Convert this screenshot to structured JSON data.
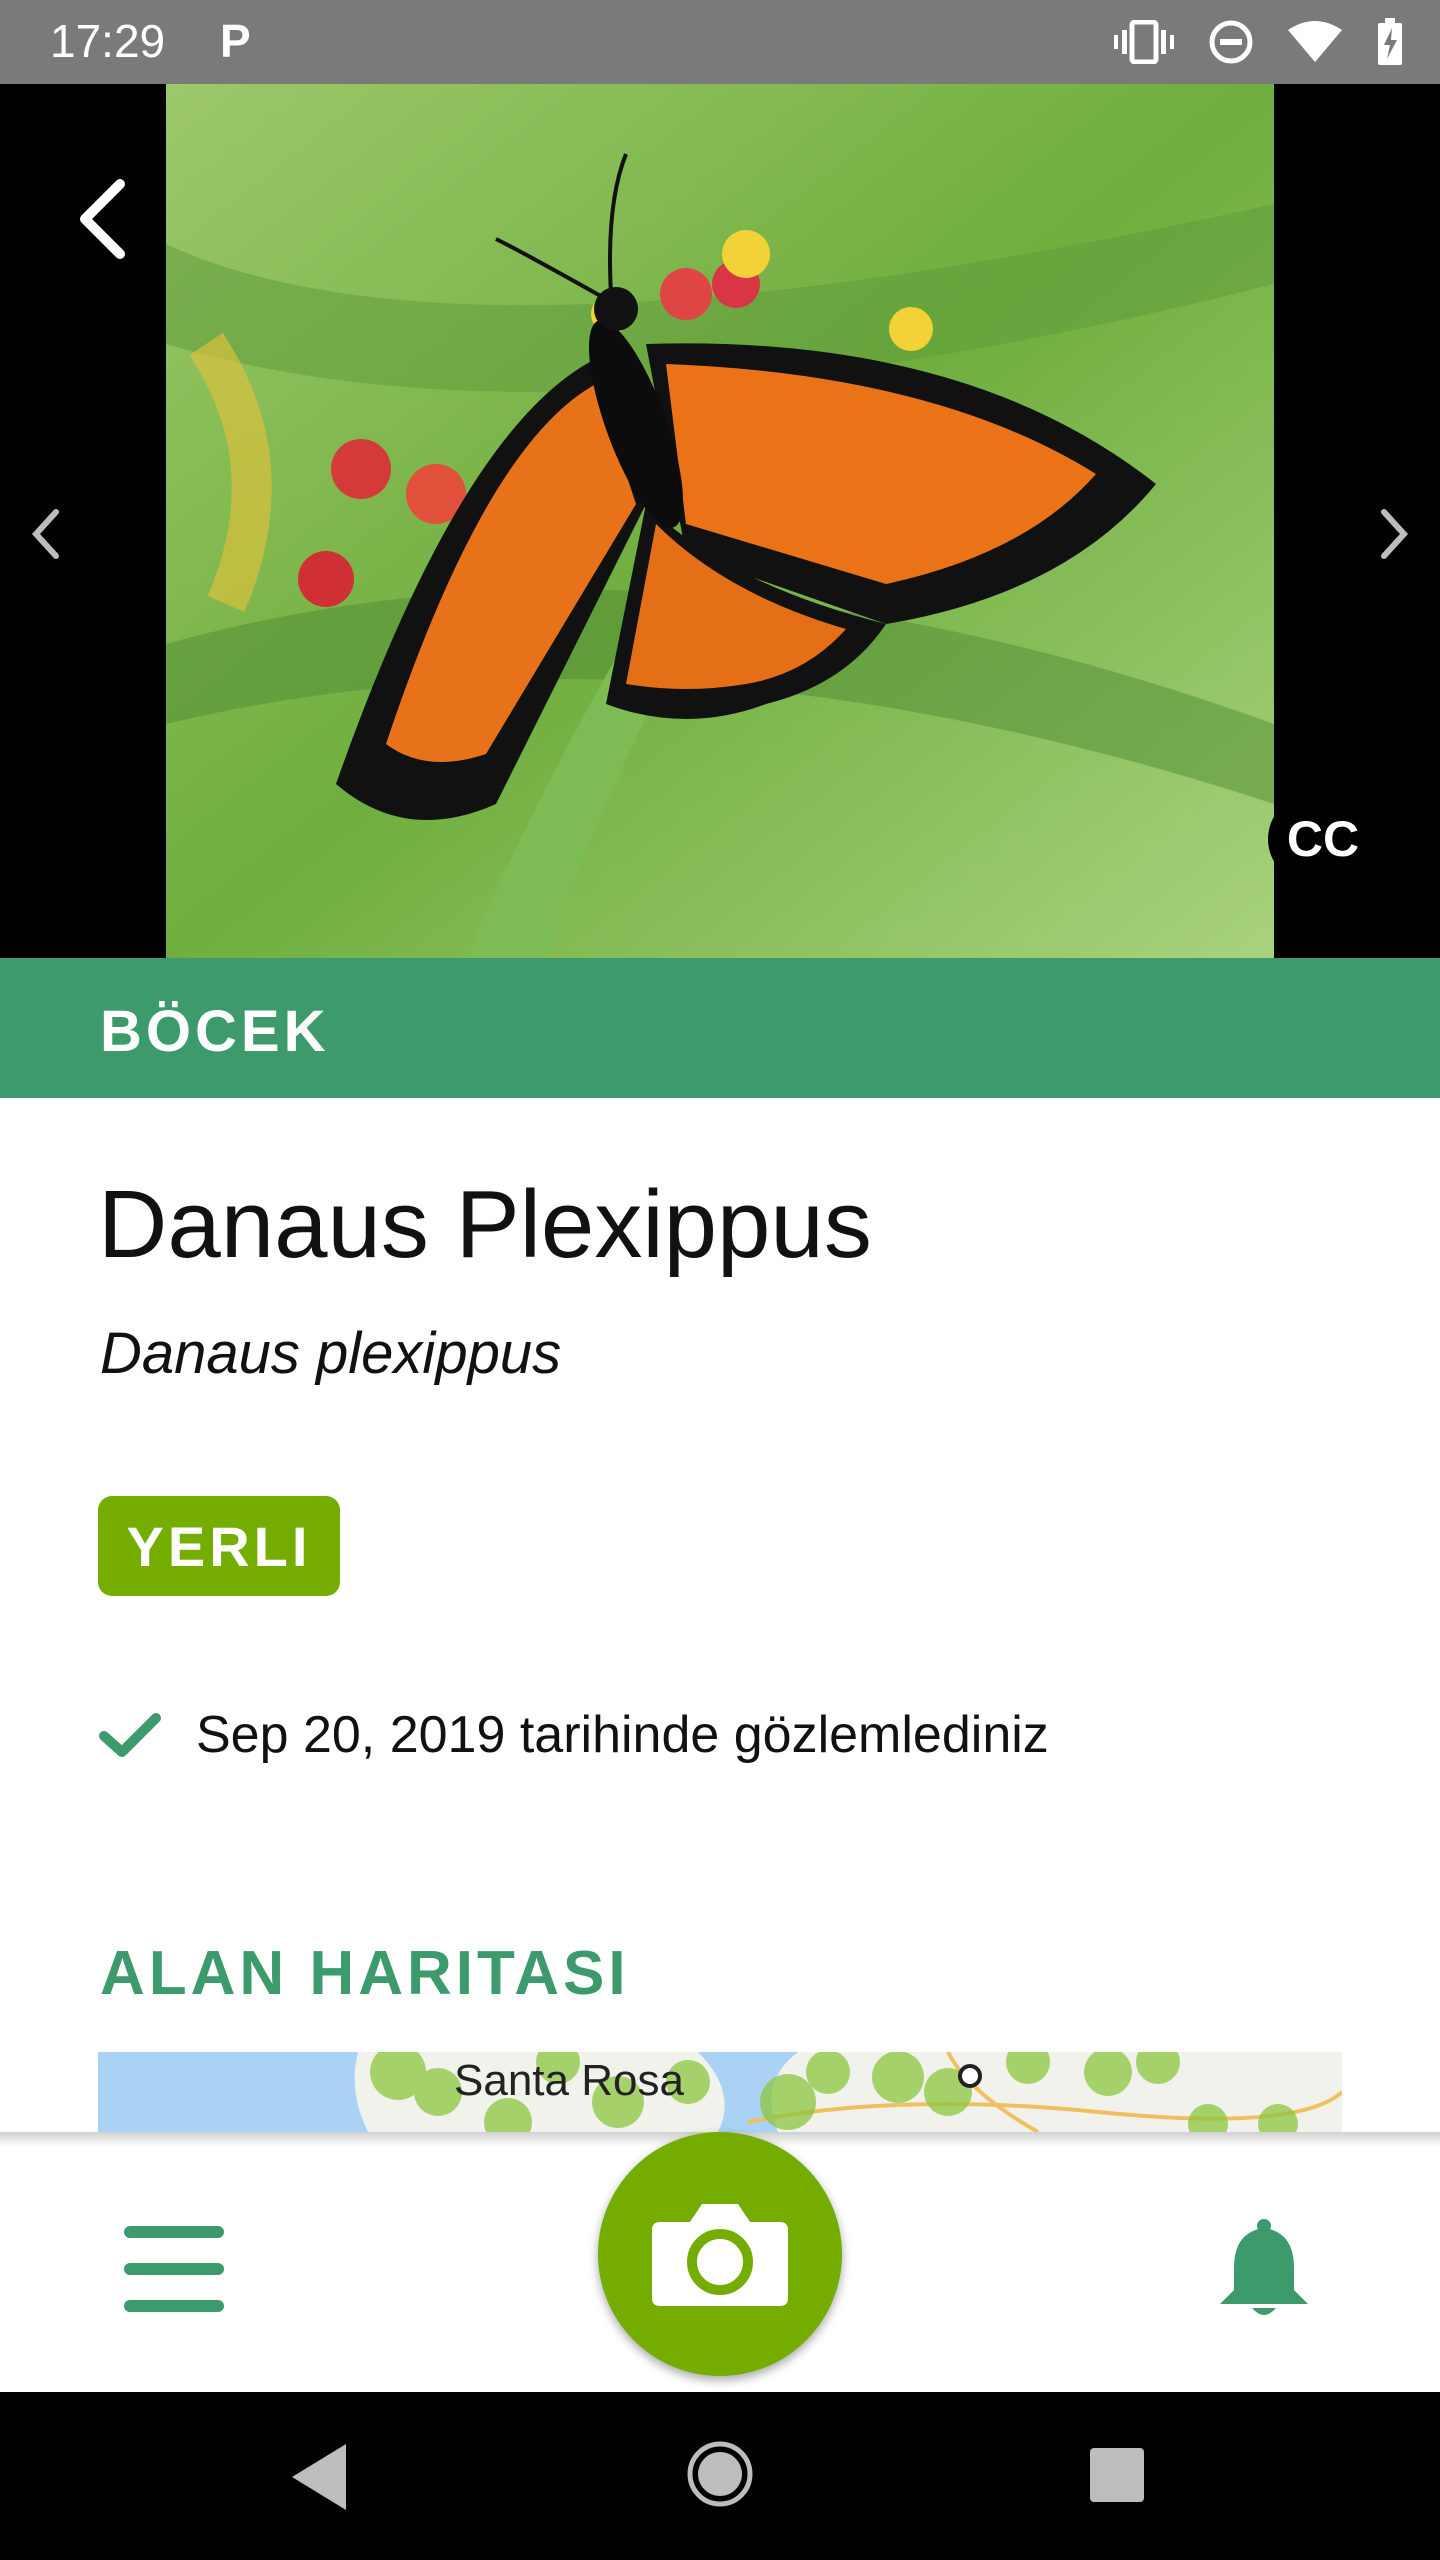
{
  "status_bar": {
    "time": "17:29",
    "notification": "P",
    "icons": [
      "vibrate-icon",
      "do-not-disturb-icon",
      "wifi-icon",
      "battery-charging-icon"
    ]
  },
  "hero": {
    "subject": "Monarch butterfly on milkweed flowers",
    "license_badge": "CC",
    "icons": [
      "back-arrow-icon",
      "chevron-left-icon",
      "chevron-right-icon"
    ]
  },
  "category": {
    "label": "BÖCEK"
  },
  "species": {
    "common_name": "Danaus Plexippus",
    "scientific_name": "Danaus plexippus",
    "status_badge": "YERLI"
  },
  "observation": {
    "text": "Sep 20, 2019 tarihinde gözlemlediniz"
  },
  "range_map": {
    "title": "ALAN HARITASI",
    "place_label": "Santa Rosa"
  },
  "bottom_nav": {
    "icons": [
      "hamburger-menu-icon",
      "camera-icon",
      "bell-icon"
    ]
  },
  "colors": {
    "brand_green": "#3c9a6d",
    "accent_green": "#74ac00",
    "status_bar": "#7a7a7a"
  }
}
